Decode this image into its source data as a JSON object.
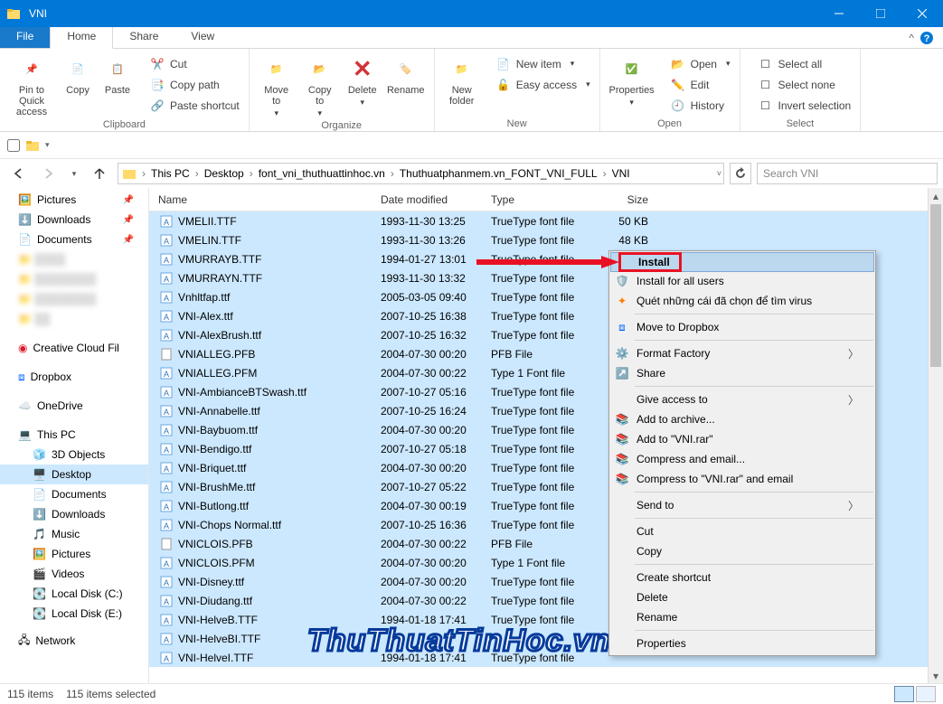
{
  "window": {
    "title": "VNI"
  },
  "tabs": {
    "file": "File",
    "home": "Home",
    "share": "Share",
    "view": "View"
  },
  "ribbon": {
    "clipboard": {
      "pin": "Pin to Quick access",
      "copy": "Copy",
      "paste": "Paste",
      "cut": "Cut",
      "copypath": "Copy path",
      "pasteshort": "Paste shortcut",
      "label": "Clipboard"
    },
    "organize": {
      "moveto": "Move to",
      "copyto": "Copy to",
      "delete": "Delete",
      "rename": "Rename",
      "label": "Organize"
    },
    "new_": {
      "newfolder": "New folder",
      "newitem": "New item",
      "easyaccess": "Easy access",
      "label": "New"
    },
    "open_": {
      "properties": "Properties",
      "open": "Open",
      "edit": "Edit",
      "history": "History",
      "label": "Open"
    },
    "select_": {
      "selectall": "Select all",
      "selectnone": "Select none",
      "invert": "Invert selection",
      "label": "Select"
    }
  },
  "breadcrumb": [
    "This PC",
    "Desktop",
    "font_vni_thuthuattinhoc.vn",
    "Thuthuatphanmem.vn_FONT_VNI_FULL",
    "VNI"
  ],
  "search": {
    "placeholder": "Search VNI"
  },
  "nav": {
    "pictures": "Pictures",
    "downloads": "Downloads",
    "documents": "Documents",
    "ccf": "Creative Cloud Fil",
    "dropbox": "Dropbox",
    "onedrive": "OneDrive",
    "thispc": "This PC",
    "obj3d": "3D Objects",
    "desktop": "Desktop",
    "docs2": "Documents",
    "dl2": "Downloads",
    "music": "Music",
    "pics2": "Pictures",
    "videos": "Videos",
    "ldc": "Local Disk (C:)",
    "lde": "Local Disk (E:)",
    "network": "Network"
  },
  "columns": {
    "name": "Name",
    "date": "Date modified",
    "type": "Type",
    "size": "Size"
  },
  "files": [
    {
      "n": "VMELII.TTF",
      "d": "1993-11-30 13:25",
      "t": "TrueType font file",
      "s": "50 KB",
      "ft": 1
    },
    {
      "n": "VMELIN.TTF",
      "d": "1993-11-30 13:26",
      "t": "TrueType font file",
      "s": "48 KB",
      "ft": 1
    },
    {
      "n": "VMURRAYB.TTF",
      "d": "1994-01-27 13:01",
      "t": "TrueType font file",
      "s": "",
      "ft": 1
    },
    {
      "n": "VMURRAYN.TTF",
      "d": "1993-11-30 13:32",
      "t": "TrueType font file",
      "s": "",
      "ft": 1
    },
    {
      "n": "Vnhltfap.ttf",
      "d": "2005-03-05 09:40",
      "t": "TrueType font file",
      "s": "",
      "ft": 1
    },
    {
      "n": "VNI-Alex.ttf",
      "d": "2007-10-25 16:38",
      "t": "TrueType font file",
      "s": "",
      "ft": 1
    },
    {
      "n": "VNI-AlexBrush.ttf",
      "d": "2007-10-25 16:32",
      "t": "TrueType font file",
      "s": "",
      "ft": 1
    },
    {
      "n": "VNIALLEG.PFB",
      "d": "2004-07-30 00:20",
      "t": "PFB File",
      "s": "",
      "ft": 0
    },
    {
      "n": "VNIALLEG.PFM",
      "d": "2004-07-30 00:22",
      "t": "Type 1 Font file",
      "s": "",
      "ft": 1
    },
    {
      "n": "VNI-AmbianceBTSwash.ttf",
      "d": "2007-10-27 05:16",
      "t": "TrueType font file",
      "s": "",
      "ft": 1
    },
    {
      "n": "VNI-Annabelle.ttf",
      "d": "2007-10-25 16:24",
      "t": "TrueType font file",
      "s": "",
      "ft": 1
    },
    {
      "n": "VNI-Baybuom.ttf",
      "d": "2004-07-30 00:20",
      "t": "TrueType font file",
      "s": "",
      "ft": 1
    },
    {
      "n": "VNI-Bendigo.ttf",
      "d": "2007-10-27 05:18",
      "t": "TrueType font file",
      "s": "",
      "ft": 1
    },
    {
      "n": "VNI-Briquet.ttf",
      "d": "2004-07-30 00:20",
      "t": "TrueType font file",
      "s": "",
      "ft": 1
    },
    {
      "n": "VNI-BrushMe.ttf",
      "d": "2007-10-27 05:22",
      "t": "TrueType font file",
      "s": "",
      "ft": 1
    },
    {
      "n": "VNI-Butlong.ttf",
      "d": "2004-07-30 00:19",
      "t": "TrueType font file",
      "s": "",
      "ft": 1
    },
    {
      "n": "VNI-Chops Normal.ttf",
      "d": "2007-10-25 16:36",
      "t": "TrueType font file",
      "s": "",
      "ft": 1
    },
    {
      "n": "VNICLOIS.PFB",
      "d": "2004-07-30 00:22",
      "t": "PFB File",
      "s": "",
      "ft": 0
    },
    {
      "n": "VNICLOIS.PFM",
      "d": "2004-07-30 00:20",
      "t": "Type 1 Font file",
      "s": "",
      "ft": 1
    },
    {
      "n": "VNI-Disney.ttf",
      "d": "2004-07-30 00:20",
      "t": "TrueType font file",
      "s": "",
      "ft": 1
    },
    {
      "n": "VNI-Diudang.ttf",
      "d": "2004-07-30 00:22",
      "t": "TrueType font file",
      "s": "",
      "ft": 1
    },
    {
      "n": "VNI-HelveB.TTF",
      "d": "1994-01-18 17:41",
      "t": "TrueType font file",
      "s": "",
      "ft": 1
    },
    {
      "n": "VNI-HelveBI.TTF",
      "d": "",
      "t": "",
      "s": "",
      "ft": 1
    },
    {
      "n": "VNI-HelveI.TTF",
      "d": "1994-01-18 17:41",
      "t": "TrueType font file",
      "s": "",
      "ft": 1
    }
  ],
  "context": {
    "install": "Install",
    "installall": "Install for all users",
    "virus": "Quét những cái đã chọn để tìm virus",
    "dropbox": "Move to Dropbox",
    "ff": "Format Factory",
    "share": "Share",
    "giveaccess": "Give access to",
    "addarch": "Add to archive...",
    "addvni": "Add to \"VNI.rar\"",
    "cemail": "Compress and email...",
    "cemailvni": "Compress to \"VNI.rar\" and email",
    "sendto": "Send to",
    "cut": "Cut",
    "copy": "Copy",
    "shortcut": "Create shortcut",
    "delete": "Delete",
    "rename": "Rename",
    "props": "Properties"
  },
  "status": {
    "items": "115 items",
    "selected": "115 items selected"
  },
  "watermark": "ThuThuatTinHoc.vn"
}
